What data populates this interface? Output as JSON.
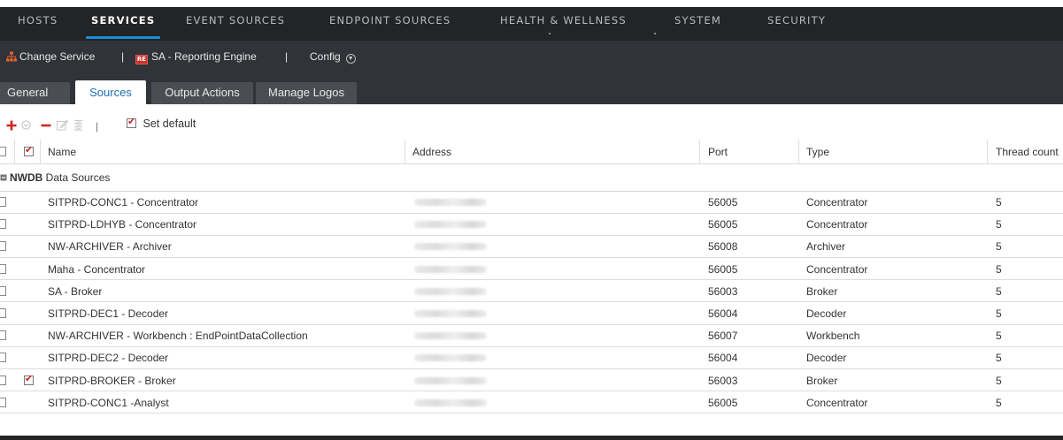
{
  "top_nav": {
    "items": [
      "HOSTS",
      "SERVICES",
      "EVENT SOURCES",
      "ENDPOINT SOURCES",
      "HEALTH & WELLNESS",
      "SYSTEM",
      "SECURITY"
    ],
    "active": "SERVICES",
    "accent_color": "#1a8fd6"
  },
  "service_bar": {
    "change_service": "Change Service",
    "separator": "|",
    "service_badge": "RE",
    "service_name": "SA - Reporting Engine",
    "config": "Config"
  },
  "tabs": {
    "items": [
      "General",
      "Sources",
      "Output Actions",
      "Manage Logos"
    ],
    "active": "Sources"
  },
  "toolbar": {
    "set_default": "Set default",
    "add_color": "#d0271f",
    "remove_color": "#d0271f"
  },
  "table": {
    "columns": {
      "name": "Name",
      "address": "Address",
      "port": "Port",
      "type": "Type",
      "thread_count": "Thread count"
    },
    "group": {
      "label_bold": "NWDB",
      "label_rest": " Data Sources"
    },
    "rows": [
      {
        "name": "SITPRD-CONC1 - Concentrator",
        "port": "56005",
        "type": "Concentrator",
        "threads": "5",
        "default": false
      },
      {
        "name": "SITPRD-LDHYB - Concentrator",
        "port": "56005",
        "type": "Concentrator",
        "threads": "5",
        "default": false
      },
      {
        "name": "NW-ARCHIVER - Archiver",
        "port": "56008",
        "type": "Archiver",
        "threads": "5",
        "default": false
      },
      {
        "name": "Maha - Concentrator",
        "port": "56005",
        "type": "Concentrator",
        "threads": "5",
        "default": false
      },
      {
        "name": "SA - Broker",
        "port": "56003",
        "type": "Broker",
        "threads": "5",
        "default": false
      },
      {
        "name": "SITPRD-DEC1 - Decoder",
        "port": "56004",
        "type": "Decoder",
        "threads": "5",
        "default": false
      },
      {
        "name": "NW-ARCHIVER - Workbench : EndPointDataCollection",
        "port": "56007",
        "type": "Workbench",
        "threads": "5",
        "default": false
      },
      {
        "name": "SITPRD-DEC2 - Decoder",
        "port": "56004",
        "type": "Decoder",
        "threads": "5",
        "default": false
      },
      {
        "name": "SITPRD-BROKER - Broker",
        "port": "56003",
        "type": "Broker",
        "threads": "5",
        "default": true
      },
      {
        "name": "SITPRD-CONC1 -Analyst",
        "port": "56005",
        "type": "Concentrator",
        "threads": "5",
        "default": false
      }
    ]
  }
}
